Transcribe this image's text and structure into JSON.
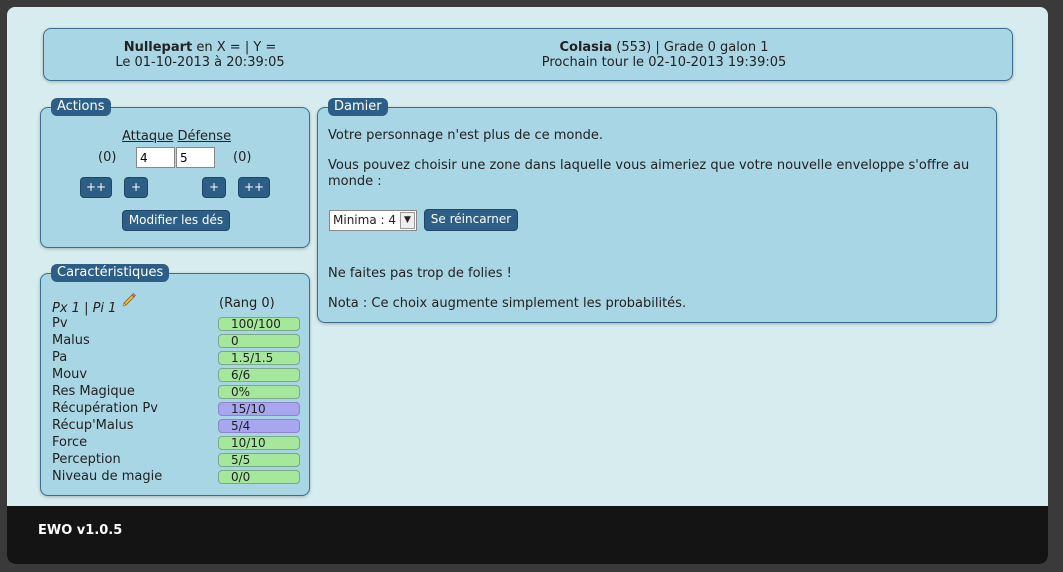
{
  "header": {
    "place_name": "Nullepart",
    "place_coords": " en X = | Y =",
    "date_line": "Le 01-10-2013 à 20:39:05",
    "char_name": "Colasia",
    "char_info": " (553) | Grade 0 galon 1",
    "next_turn": "Prochain tour le 02-10-2013 19:39:05"
  },
  "actions": {
    "legend": "Actions",
    "attack_label": "Attaque",
    "defense_label": "Défense",
    "attack_count": "(0)",
    "defense_count": "(0)",
    "attack_value": "4",
    "defense_value": "5",
    "btn_attack_plusplus": "++",
    "btn_attack_plus": "+",
    "btn_defense_plus": "+",
    "btn_defense_plusplus": "++",
    "modify_label": "Modifier les dés"
  },
  "carac": {
    "legend": "Caractéristiques",
    "px_line": "Px 1 | Pi 1",
    "rang": "(Rang 0)",
    "stats": [
      {
        "label": "Pv",
        "value": "100/100",
        "color": "green"
      },
      {
        "label": "Malus",
        "value": "0",
        "color": "green"
      },
      {
        "label": "Pa",
        "value": "1.5/1.5",
        "color": "green"
      },
      {
        "label": "Mouv",
        "value": "6/6",
        "color": "green"
      },
      {
        "label": "Res Magique",
        "value": "0%",
        "color": "green"
      },
      {
        "label": "Récupération Pv",
        "value": "15/10",
        "color": "purple"
      },
      {
        "label": "Récup'Malus",
        "value": "5/4",
        "color": "purple"
      },
      {
        "label": "Force",
        "value": "10/10",
        "color": "green"
      },
      {
        "label": "Perception",
        "value": "5/5",
        "color": "green"
      },
      {
        "label": "Niveau de magie",
        "value": "0/0",
        "color": "green"
      }
    ]
  },
  "damier": {
    "legend": "Damier",
    "line1": "Votre personnage n'est plus de ce monde.",
    "line2": "Vous pouvez choisir une zone dans laquelle vous aimeriez que votre nouvelle enveloppe s'offre au monde :",
    "select_value": "Minima : 4",
    "reincarnate_label": "Se réincarner",
    "line3": "Ne faites pas trop de folies !",
    "line4": "Nota : Ce choix augmente simplement les probabilités."
  },
  "footer": {
    "version": "EWO v1.0.5"
  },
  "colors": {
    "panel_bg": "#a9d6e5",
    "accent": "#2d5f86",
    "bar_green": "#a6e89b",
    "bar_purple": "#a9a6f0"
  }
}
